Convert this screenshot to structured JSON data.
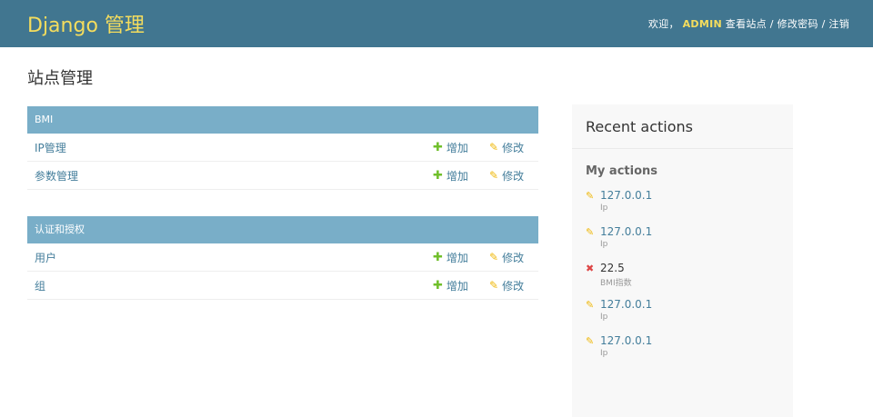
{
  "header": {
    "brand": "Django 管理",
    "welcome": "欢迎，",
    "username": "ADMIN",
    "view_site": "查看站点",
    "change_password": "修改密码",
    "logout": "注销",
    "sep": " / "
  },
  "page_title": "站点管理",
  "modules": [
    {
      "caption": "BMI",
      "rows": [
        {
          "name": "IP管理",
          "add": "增加",
          "change": "修改"
        },
        {
          "name": "参数管理",
          "add": "增加",
          "change": "修改"
        }
      ]
    },
    {
      "caption": "认证和授权",
      "rows": [
        {
          "name": "用户",
          "add": "增加",
          "change": "修改"
        },
        {
          "name": "组",
          "add": "增加",
          "change": "修改"
        }
      ]
    }
  ],
  "recent": {
    "title": "Recent actions",
    "subtitle": "My actions",
    "items": [
      {
        "icon": "pencil-icon",
        "label": "127.0.0.1",
        "type": "Ip"
      },
      {
        "icon": "pencil-icon",
        "label": "127.0.0.1",
        "type": "Ip"
      },
      {
        "icon": "delete-x-icon",
        "label": "22.5",
        "type": "BMI指数"
      },
      {
        "icon": "pencil-icon",
        "label": "127.0.0.1",
        "type": "Ip"
      },
      {
        "icon": "pencil-icon",
        "label": "127.0.0.1",
        "type": "Ip"
      }
    ]
  },
  "colors": {
    "header_bg": "#417690",
    "brand": "#f5dd5d",
    "module_caption_bg": "#79aec8",
    "link": "#447e9b",
    "add_icon": "#70bf2b",
    "change_icon": "#efb80b",
    "delete_icon": "#dd4646"
  }
}
